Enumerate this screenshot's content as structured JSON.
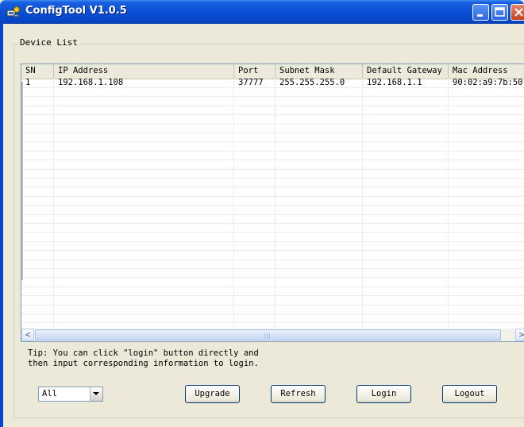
{
  "window": {
    "title": "ConfigTool V1.0.5"
  },
  "device_list": {
    "label": "Device List",
    "columns": [
      "SN",
      "IP Address",
      "Port",
      "Subnet Mask",
      "Default Gateway",
      "Mac Address"
    ],
    "rows": [
      [
        "1",
        "192.168.1.108",
        "37777",
        "255.255.255.0",
        "192.168.1.1",
        "90:02:a9:7b:50"
      ]
    ]
  },
  "scrollbar": {
    "left_arrow": "<",
    "right_arrow": ">"
  },
  "tip": "Tip: You can click \"login\" button directly and\nthen input corresponding information to login.",
  "filter": {
    "selected": "All"
  },
  "buttons": {
    "upgrade": "Upgrade",
    "refresh": "Refresh",
    "login": "Login",
    "logout": "Logout"
  },
  "icons": [
    "app-icon",
    "minimize-icon",
    "maximize-icon",
    "close-icon",
    "chevron-down-icon",
    "scroll-grip-icon"
  ],
  "colors": {
    "titlebar": "#0a4fd6",
    "window_bg": "#ece9d8",
    "close_button": "#c4401f"
  }
}
